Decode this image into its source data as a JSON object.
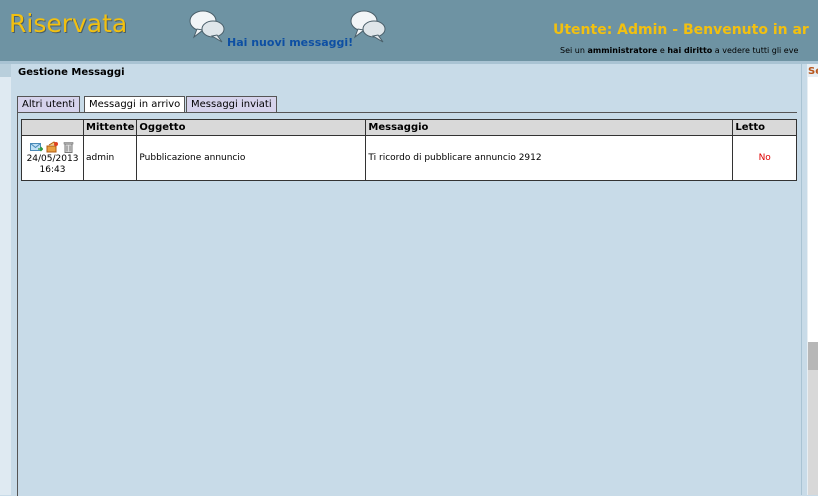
{
  "header": {
    "logo": "Riservata",
    "new_messages_link": "Hai nuovi messaggi!",
    "welcome": "Utente: Admin - Benvenuto in ar",
    "sub_pre": "Sei un ",
    "sub_role": "amministratore",
    "sub_mid": " e ",
    "sub_right": "hai diritto",
    "sub_post": " a vedere tutti gli eve",
    "logo_color": "#f2c010",
    "header_color": "#6e93a3"
  },
  "main": {
    "title": "Gestione Messaggi",
    "tabs": [
      {
        "label": "Altri utenti",
        "active": false
      },
      {
        "label": "Messaggi in arrivo",
        "active": true
      },
      {
        "label": "Messaggi inviati",
        "active": false
      }
    ],
    "table": {
      "columns": [
        "",
        "Mittente",
        "Oggetto",
        "Messaggio",
        "Letto"
      ],
      "rows": [
        {
          "date": "24/05/2013",
          "time": "16:43",
          "sender": "admin",
          "subject": "Pubblicazione annuncio",
          "message": "Ti ricordo di pubblicare annuncio 2912",
          "read": "No",
          "icons": [
            "reply-mail-icon",
            "forward-icon",
            "trash-icon"
          ]
        }
      ]
    }
  },
  "right_panel": {
    "title_fragment": "Se"
  },
  "icons": {
    "speech_bubbles": "speech-bubbles-icon"
  },
  "colors": {
    "page_bg": "#c8dbe8",
    "unread": "#e00000",
    "link": "#0d4fa3"
  }
}
